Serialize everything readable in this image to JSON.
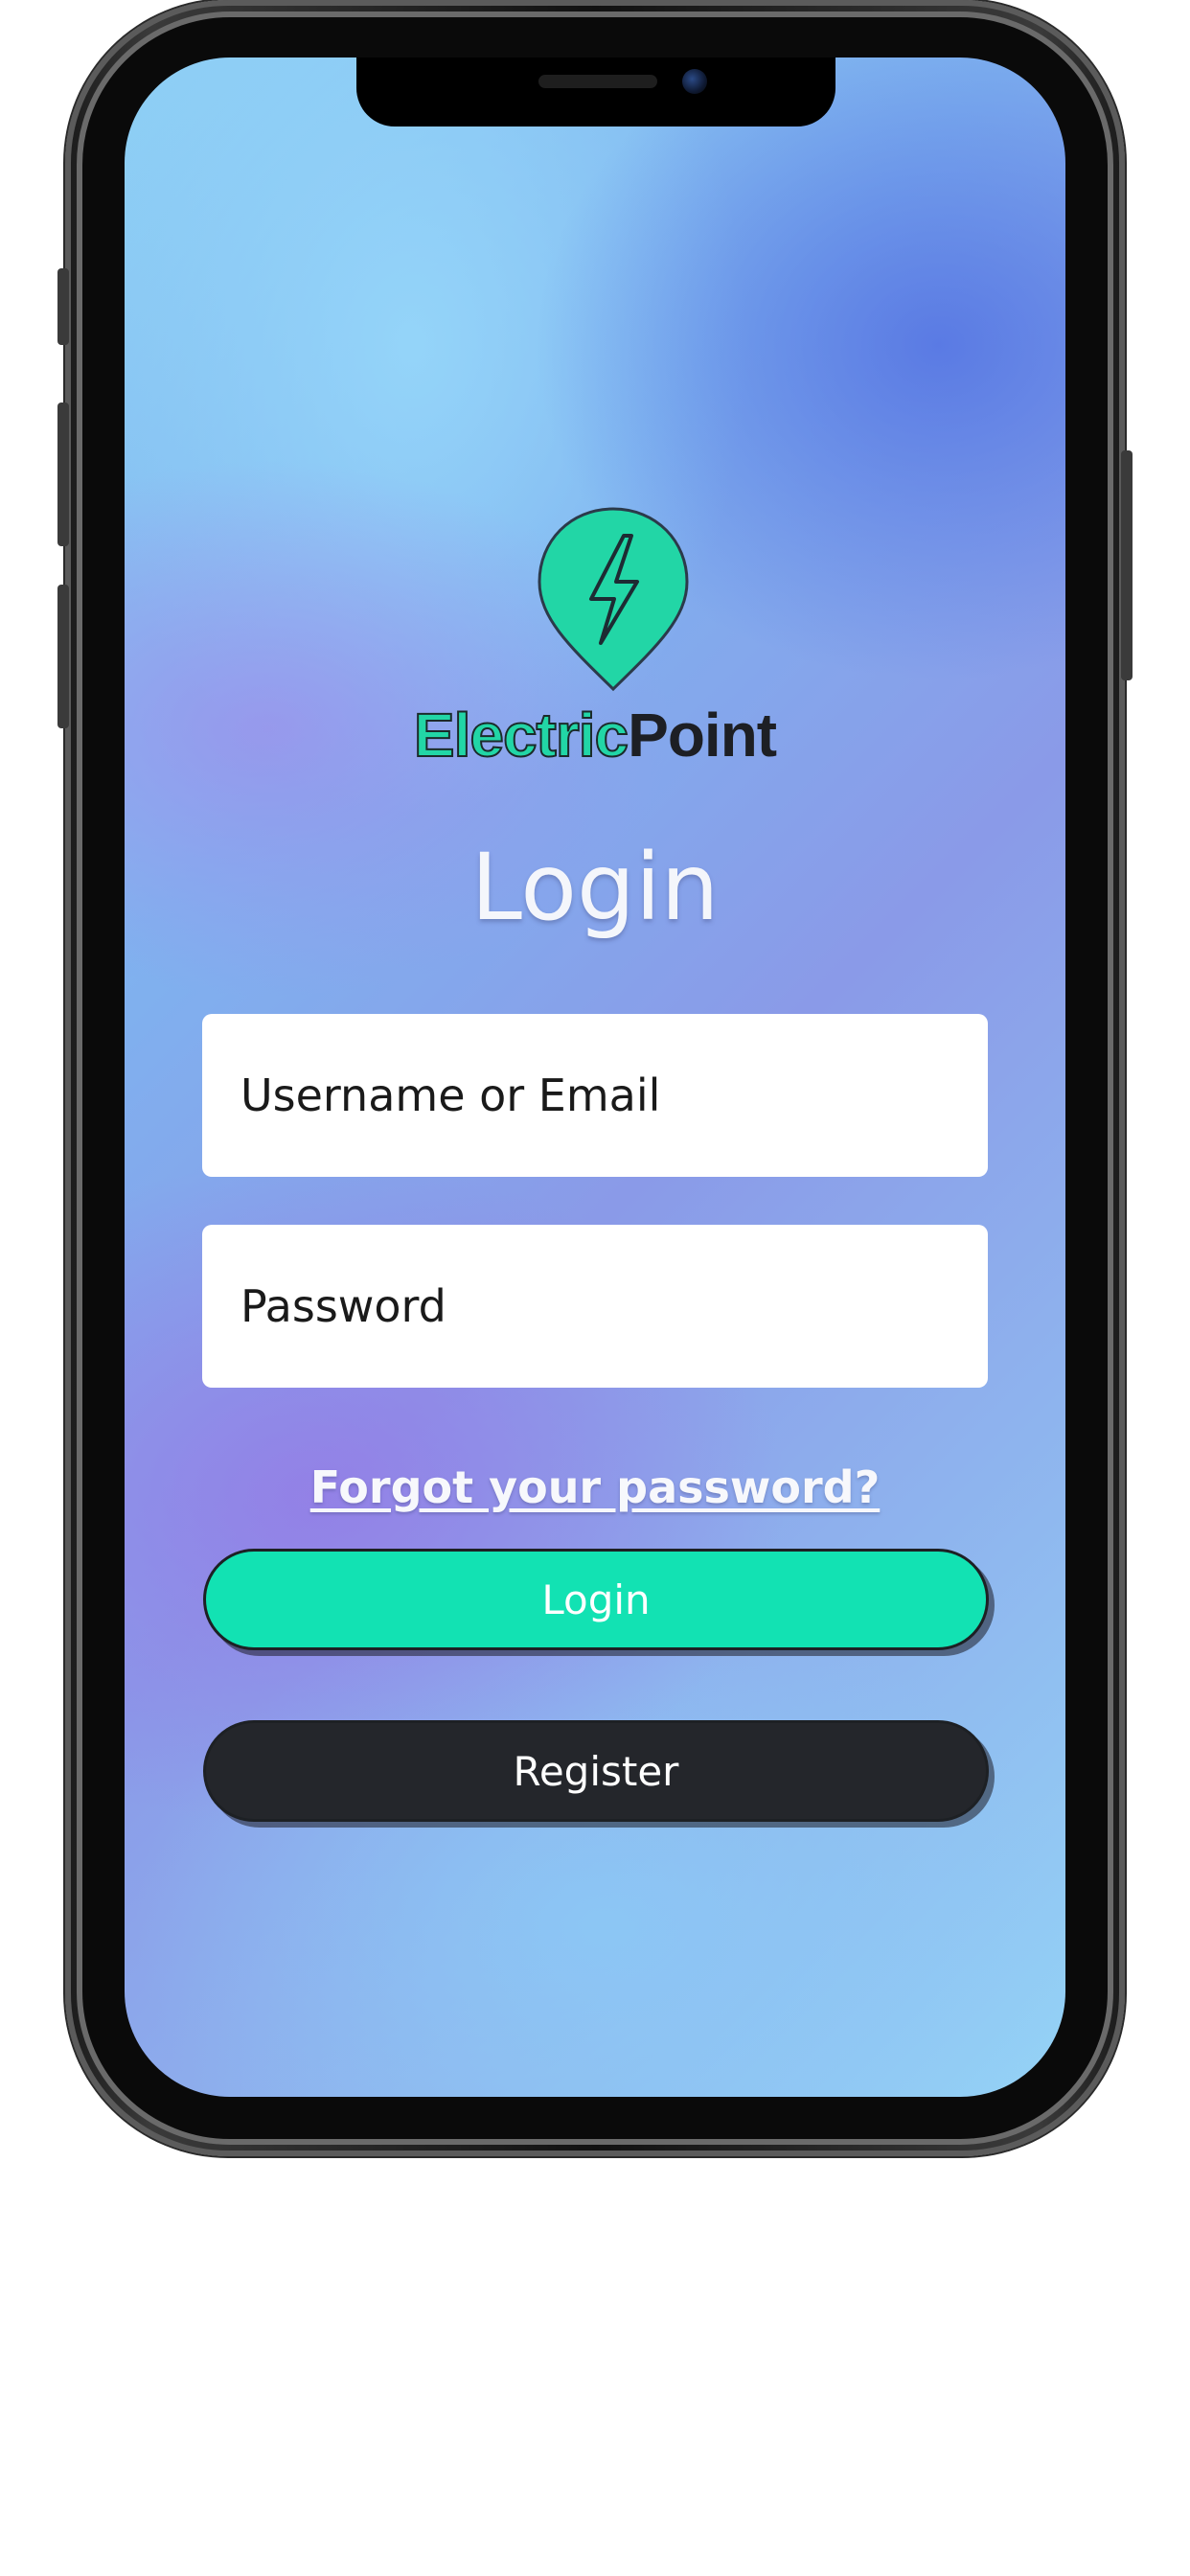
{
  "brand": {
    "name_part1": "Electric",
    "name_part2": "Point",
    "pin_color": "#22d6a6",
    "bolt_icon": "lightning-bolt-icon"
  },
  "login": {
    "title": "Login",
    "username_placeholder": "Username or Email",
    "password_placeholder": "Password",
    "forgot_link": "Forgot your password?",
    "login_button": "Login",
    "register_button": "Register"
  },
  "colors": {
    "login_button": "#12e2b3",
    "register_button": "#24262b",
    "field_background": "#ffffff",
    "title_text": "#f4f6fb"
  }
}
